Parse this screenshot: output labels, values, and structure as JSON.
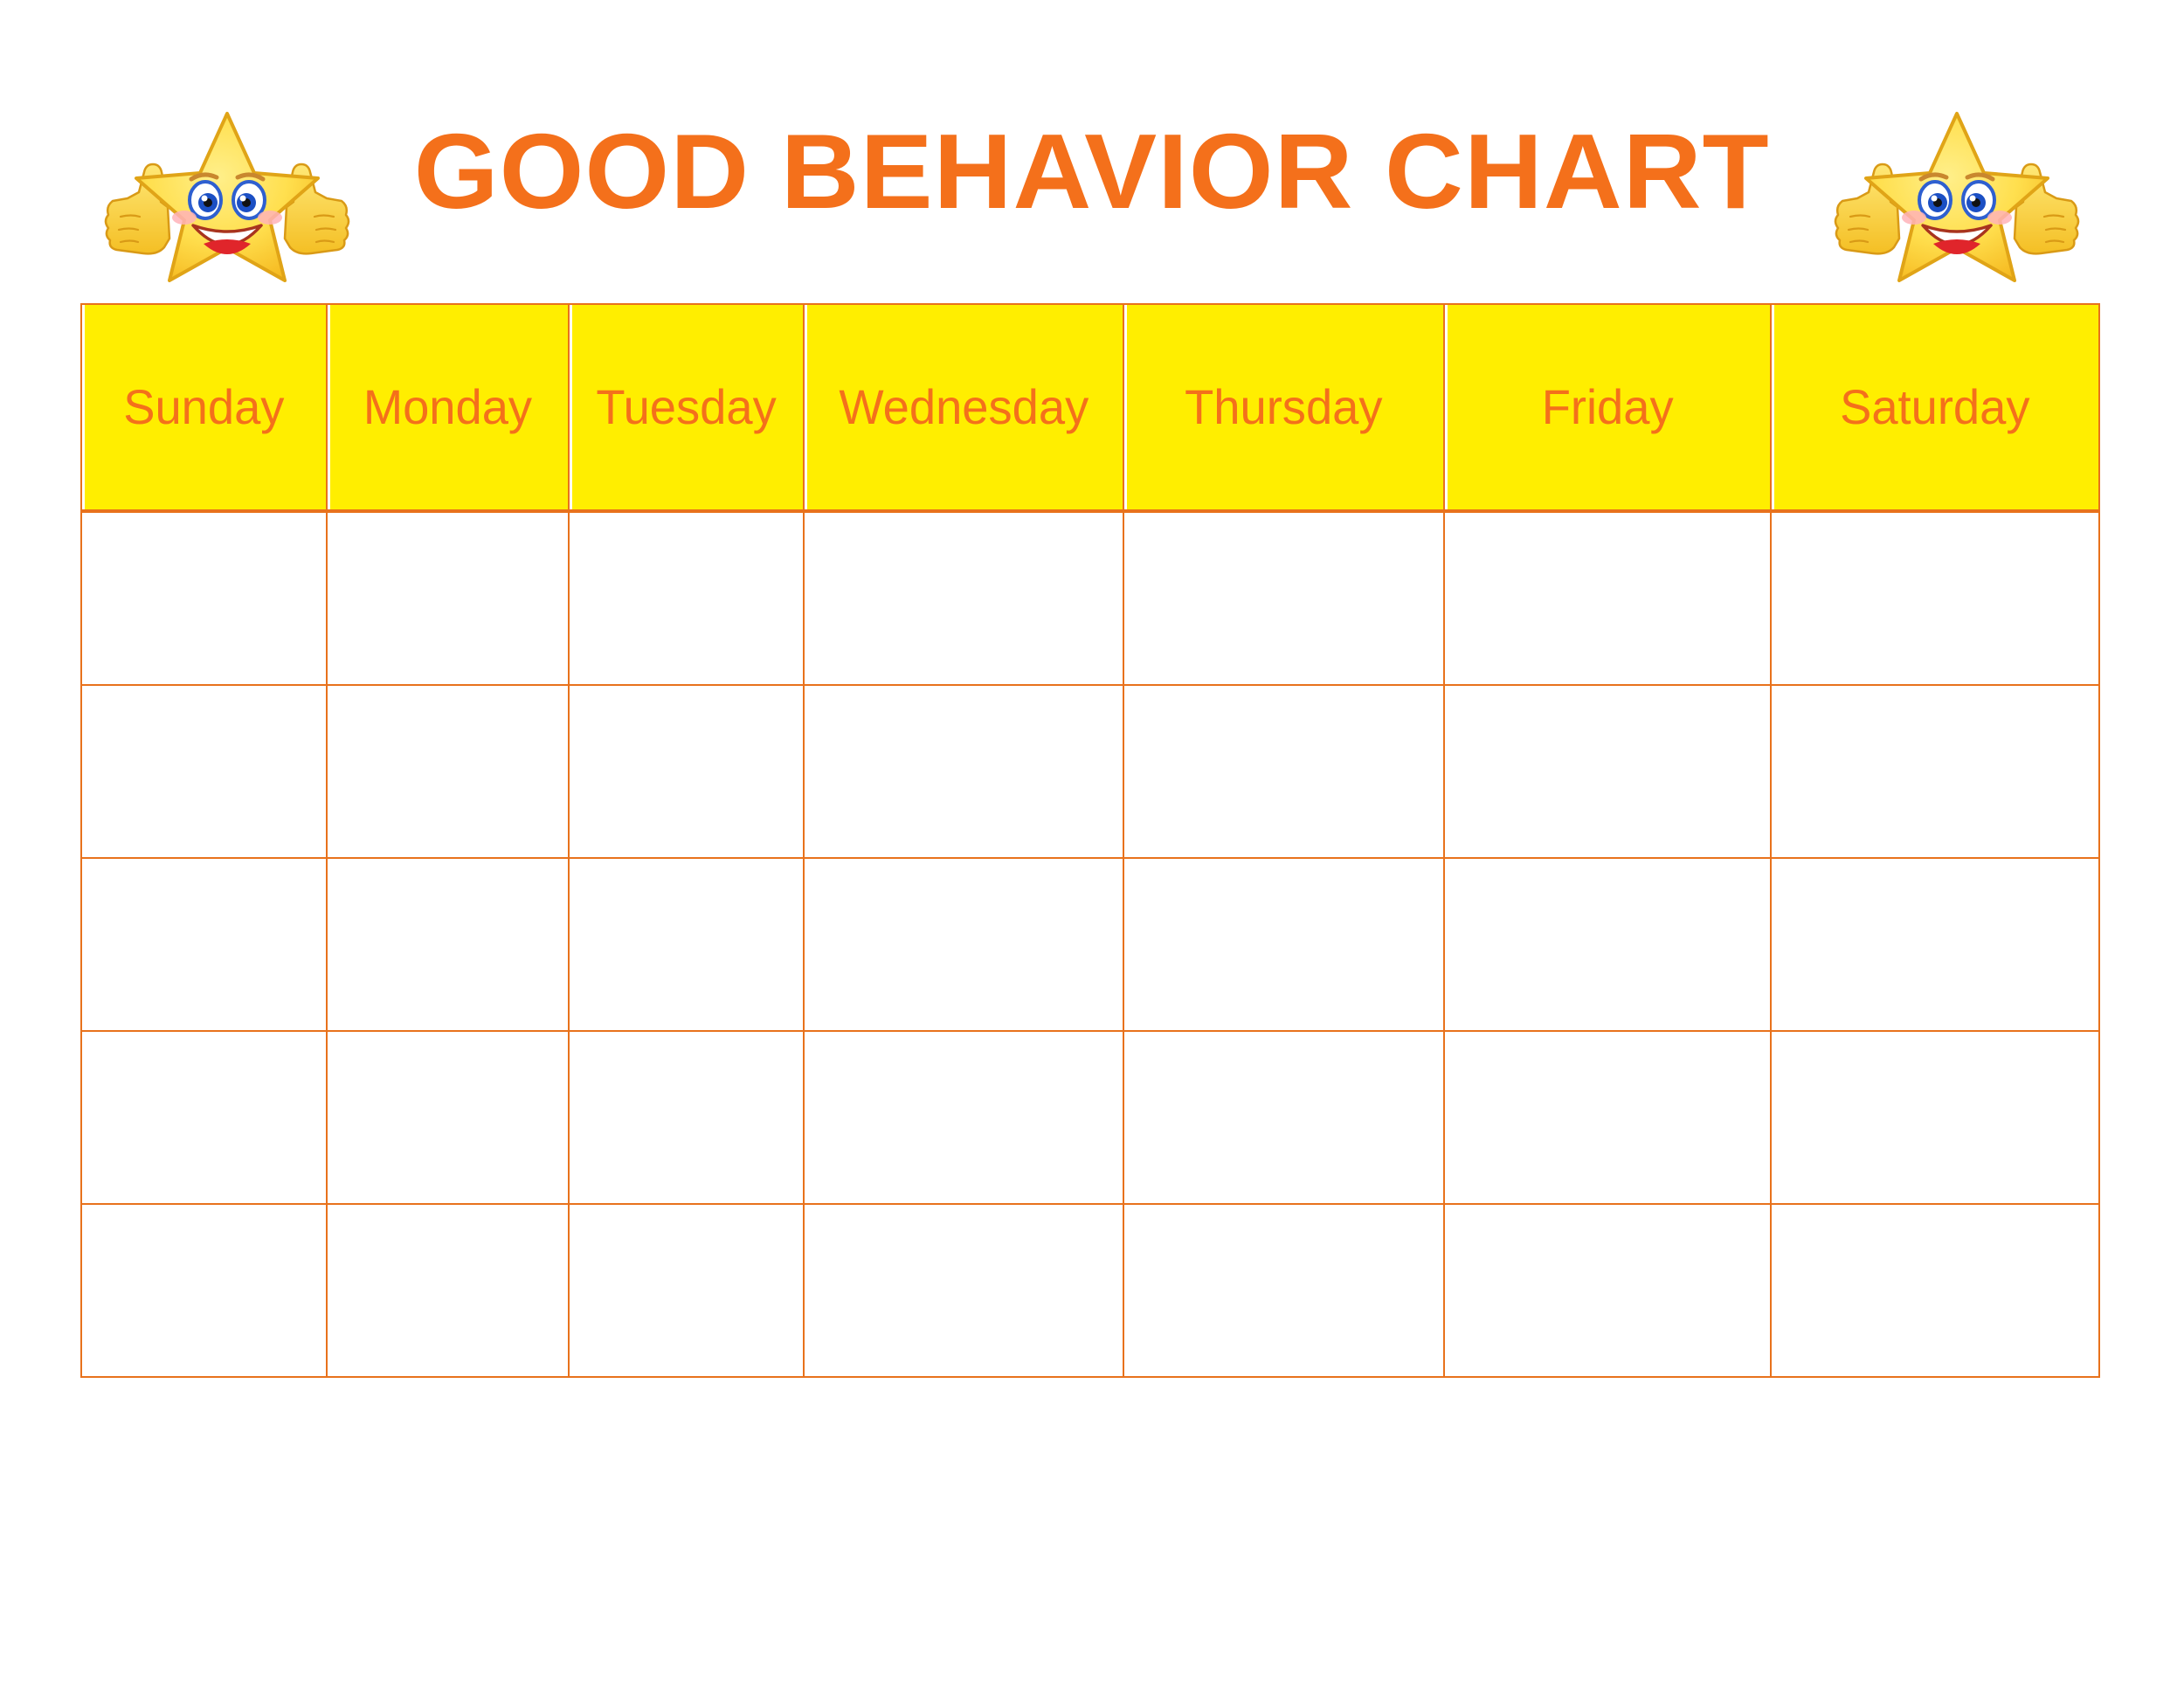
{
  "page": {
    "title": "GOOD BEHAVIOR CHART",
    "background_color": "#ffffff",
    "accent_color": "#f4701b",
    "header_fill_color": "#ffee00",
    "border_color": "#e8721c"
  },
  "decorations": {
    "left_star": "thumbs-up-star-icon",
    "right_star": "thumbs-up-star-icon"
  },
  "table": {
    "columns": [
      {
        "label": "Sunday"
      },
      {
        "label": "Monday"
      },
      {
        "label": "Tuesday"
      },
      {
        "label": "Wednesday"
      },
      {
        "label": "Thursday"
      },
      {
        "label": "Friday"
      },
      {
        "label": "Saturday"
      }
    ],
    "rows": [
      {
        "cells": [
          "",
          "",
          "",
          "",
          "",
          "",
          ""
        ]
      },
      {
        "cells": [
          "",
          "",
          "",
          "",
          "",
          "",
          ""
        ]
      },
      {
        "cells": [
          "",
          "",
          "",
          "",
          "",
          "",
          ""
        ]
      },
      {
        "cells": [
          "",
          "",
          "",
          "",
          "",
          "",
          ""
        ]
      },
      {
        "cells": [
          "",
          "",
          "",
          "",
          "",
          "",
          ""
        ]
      }
    ]
  }
}
